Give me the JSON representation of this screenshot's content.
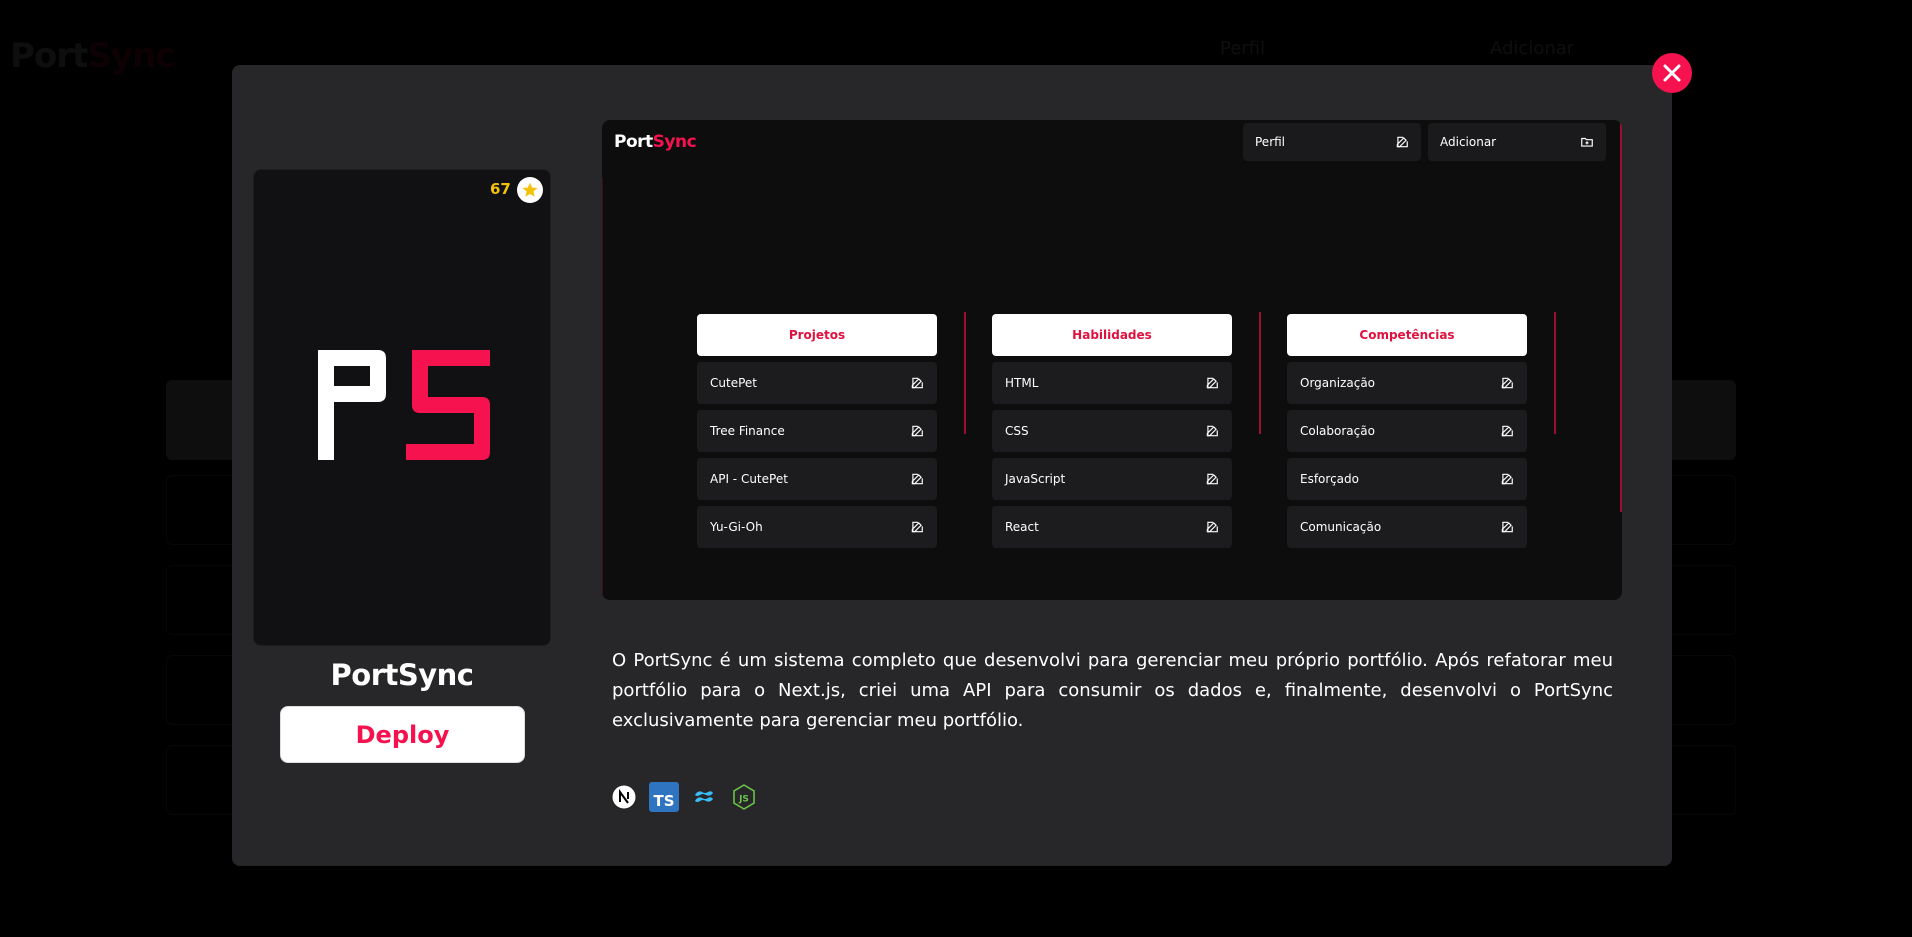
{
  "background": {
    "logo_main": "Port",
    "logo_accent": "Sync",
    "nav": [
      "Perfil",
      "Adicionar"
    ]
  },
  "modal": {
    "stars": "67",
    "project_title": "PortSync",
    "deploy_label": "Deploy",
    "description": "O PortSync é um sistema completo que desenvolvi para gerenciar meu próprio portfólio. Após refatorar meu portfólio para o Next.js, criei uma API para consumir os dados e, finalmente, desenvolvi o PortSync exclusivamente para gerenciar meu portfólio.",
    "tech_icons": [
      "nextjs-icon",
      "typescript-icon",
      "tailwind-icon",
      "nodejs-icon"
    ]
  },
  "preview": {
    "logo_main": "Port",
    "logo_accent": "Sync",
    "nav": {
      "perfil": "Perfil",
      "adicionar": "Adicionar"
    },
    "columns": [
      {
        "title": "Projetos",
        "items": [
          "CutePet",
          "Tree Finance",
          "API - CutePet",
          "Yu-Gi-Oh"
        ]
      },
      {
        "title": "Habilidades",
        "items": [
          "HTML",
          "CSS",
          "JavaScript",
          "React"
        ]
      },
      {
        "title": "Competências",
        "items": [
          "Organização",
          "Colaboração",
          "Esforçado",
          "Comunicação"
        ]
      }
    ]
  },
  "colors": {
    "accent": "#f5124e",
    "modal_bg": "#272729",
    "star": "#f4c20d"
  }
}
